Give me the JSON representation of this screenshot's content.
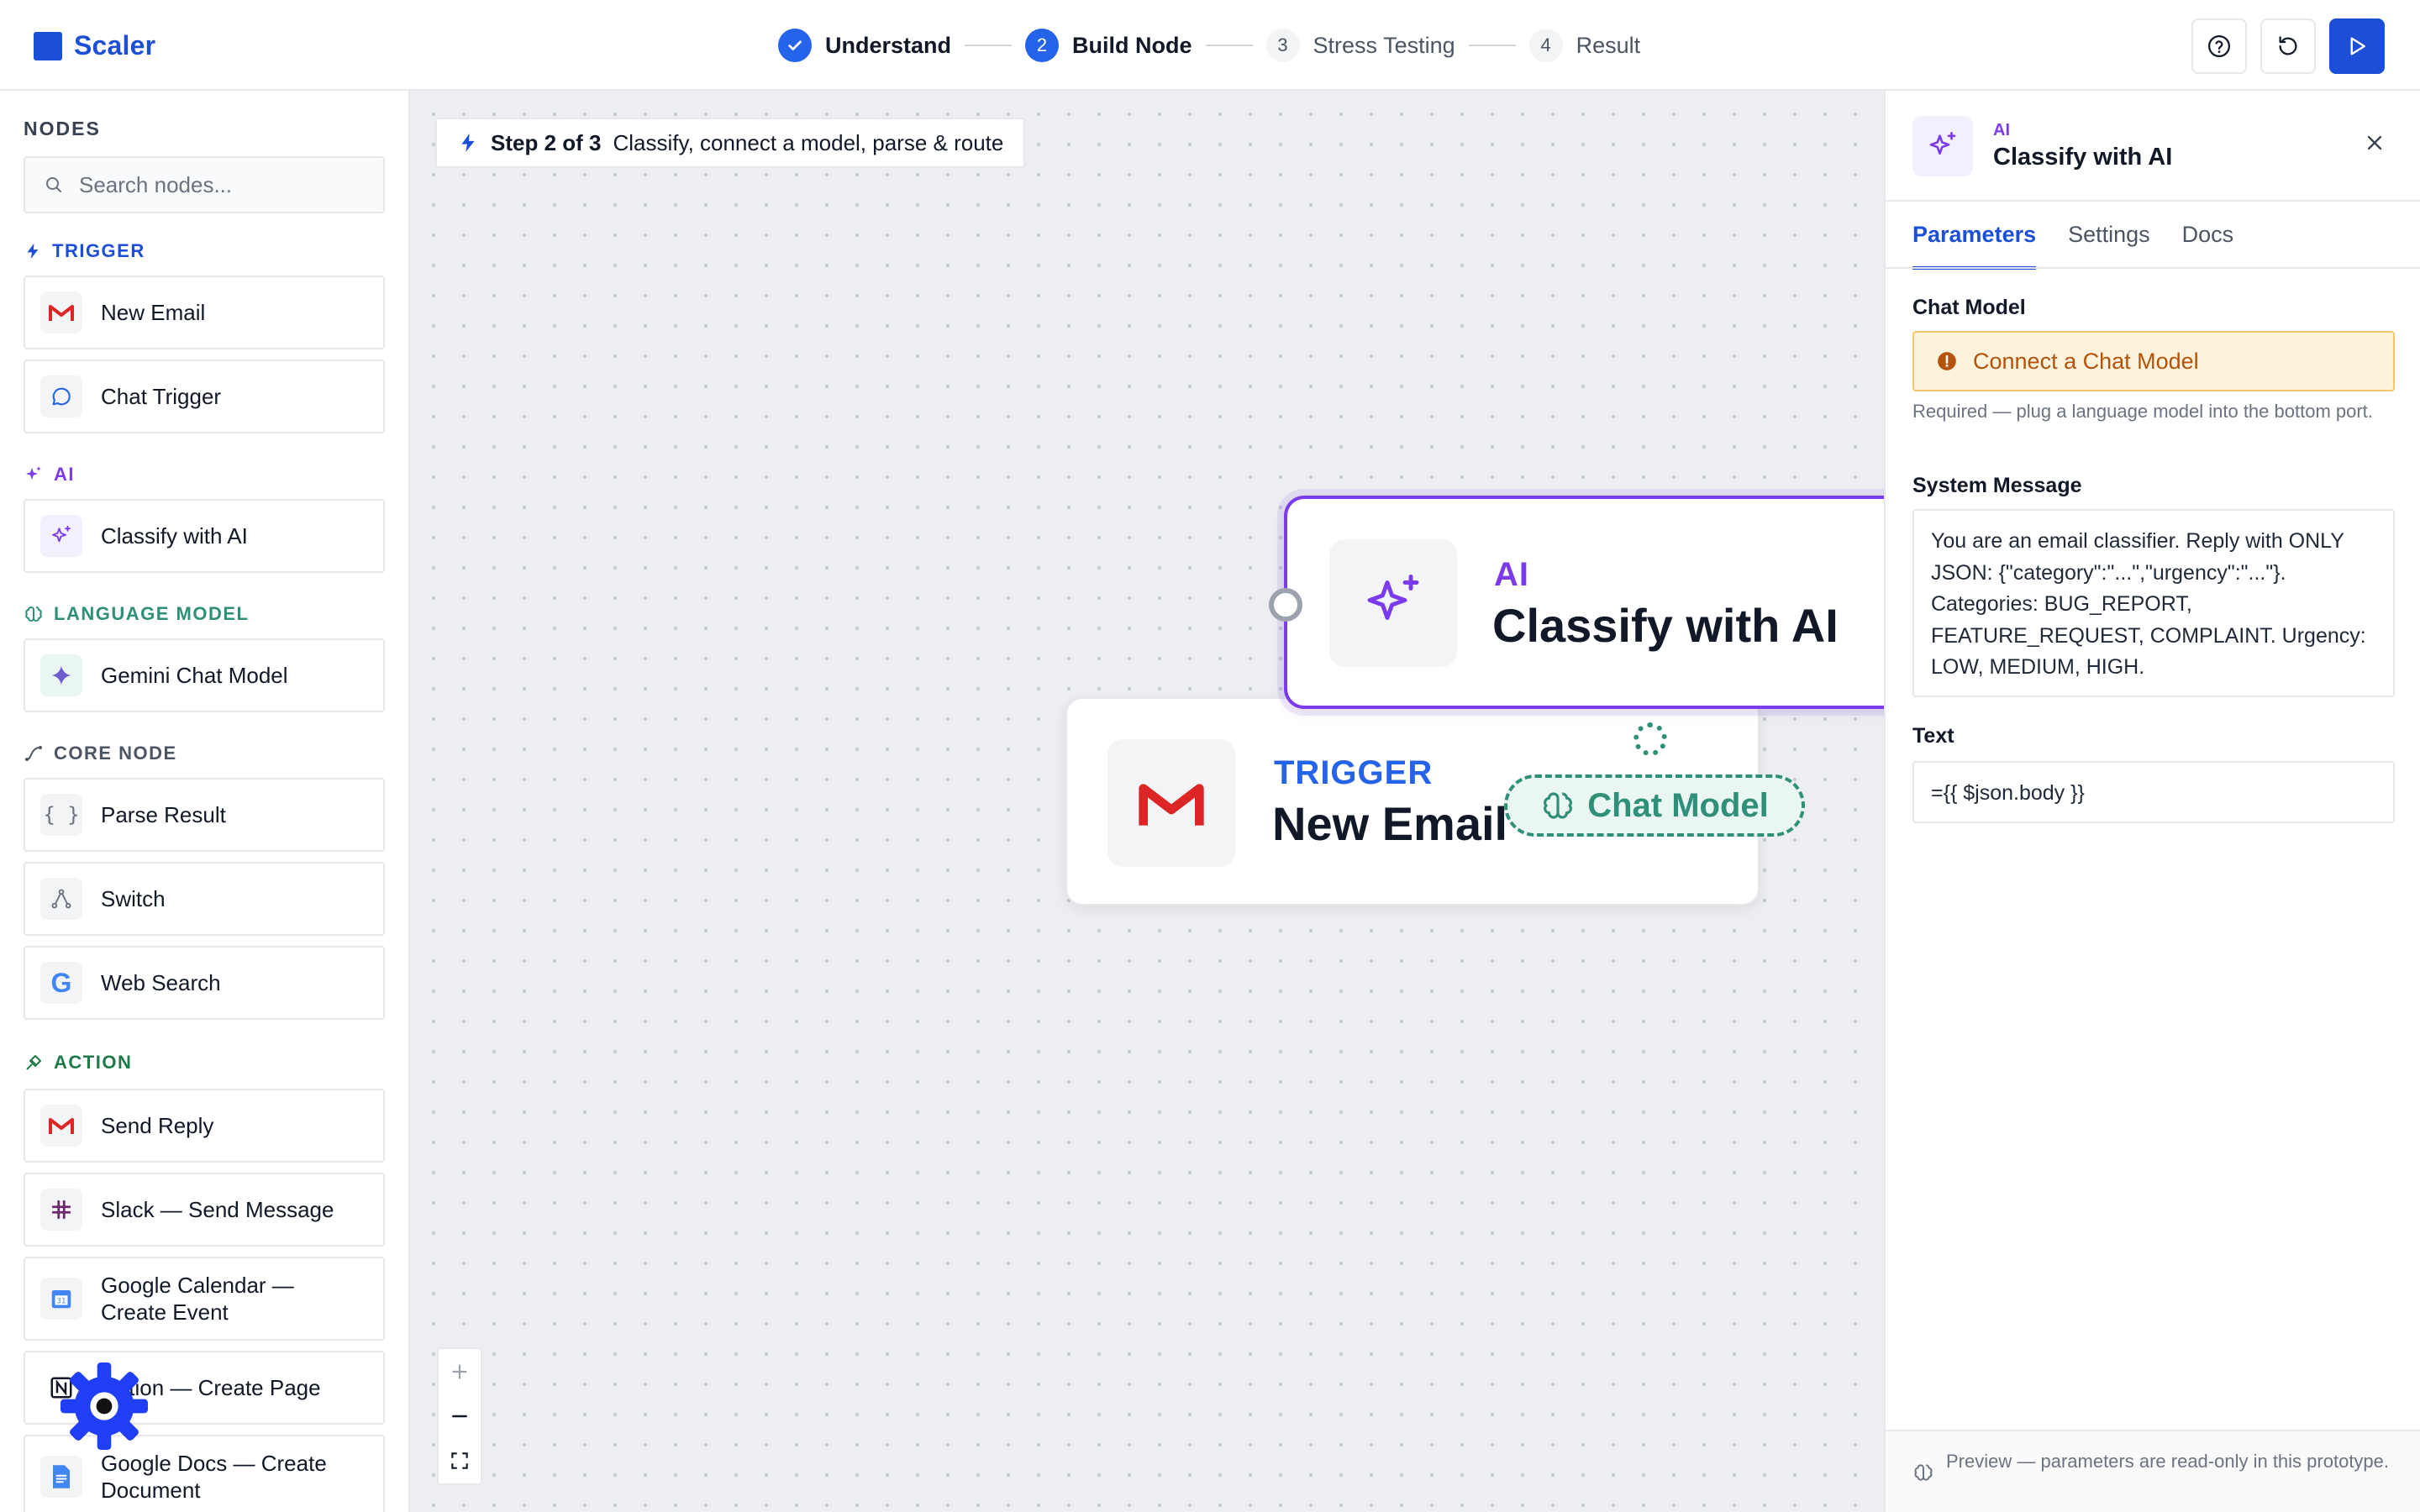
{
  "brand": {
    "name": "Scaler"
  },
  "stepper": [
    {
      "num": "",
      "label": "Understand",
      "state": "done"
    },
    {
      "num": "2",
      "label": "Build Node",
      "state": "current"
    },
    {
      "num": "3",
      "label": "Stress Testing",
      "state": "todo"
    },
    {
      "num": "4",
      "label": "Result",
      "state": "todo"
    }
  ],
  "sidebar": {
    "title": "NODES",
    "search_placeholder": "Search nodes...",
    "categories": {
      "trigger": "TRIGGER",
      "ai": "AI",
      "language_model": "LANGUAGE MODEL",
      "core_node": "CORE NODE",
      "action": "ACTION"
    },
    "items": {
      "new_email": "New Email",
      "chat_trigger": "Chat Trigger",
      "classify_ai": "Classify with AI",
      "gemini": "Gemini Chat Model",
      "parse_result": "Parse Result",
      "switch": "Switch",
      "web_search": "Web Search",
      "send_reply": "Send Reply",
      "slack": "Slack — Send Message",
      "gcal": "Google Calendar — Create Event",
      "notion": "Notion — Create Page",
      "gdocs": "Google Docs — Create Document"
    }
  },
  "canvas": {
    "banner_step": "Step 2 of 3",
    "banner_text": "Classify, connect a model, parse & route",
    "trigger_card": {
      "kicker": "TRIGGER",
      "title": "New Email"
    },
    "ai_card": {
      "kicker": "AI",
      "title": "Classify with AI"
    },
    "chat_model_pill": "Chat Model"
  },
  "panel": {
    "kicker": "AI",
    "title": "Classify with AI",
    "tabs": [
      "Parameters",
      "Settings",
      "Docs"
    ],
    "chat_model_label": "Chat Model",
    "chat_model_warning": "Connect a Chat Model",
    "chat_model_help": "Required — plug a language model into the bottom port.",
    "system_message_label": "System Message",
    "system_message": "You are an email classifier. Reply with ONLY JSON: {\"category\":\"...\",\"urgency\":\"...\"}. Categories: BUG_REPORT, FEATURE_REQUEST, COMPLAINT. Urgency: LOW, MEDIUM, HIGH.",
    "text_label": "Text",
    "text_value": "={{ $json.body }}",
    "footer": "Preview — parameters are read-only in this prototype."
  },
  "colors": {
    "accent": "#1d4ed8",
    "ai": "#7c3aed",
    "language_model": "#2f8f78",
    "action": "#1f7a4a",
    "warning": "#b45309"
  }
}
